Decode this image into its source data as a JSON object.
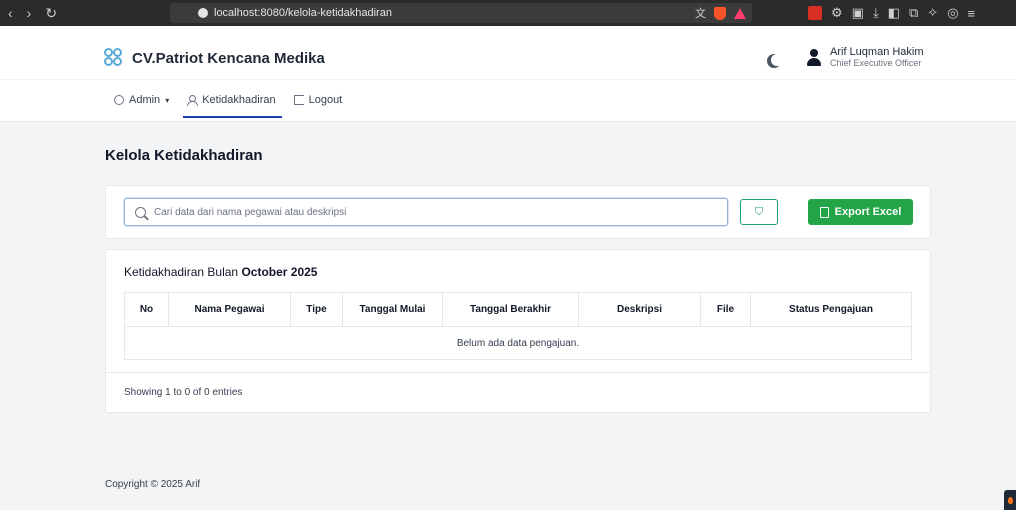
{
  "browser": {
    "url": "localhost:8080/kelola-ketidakhadiran",
    "nav_back": "‹",
    "nav_forward": "›",
    "nav_reload": "↻"
  },
  "header": {
    "brand": "CV.Patriot Kencana Medika",
    "user_name": "Arif Luqman Hakim",
    "user_role": "Chief Executive Officer"
  },
  "menu": {
    "items": [
      {
        "label": "Admin",
        "icon": "user-circle-icon"
      },
      {
        "label": "Ketidakhadiran",
        "icon": "person-x-icon"
      },
      {
        "label": "Logout",
        "icon": "logout-icon"
      }
    ],
    "active": "Ketidakhadiran"
  },
  "page": {
    "title": "Kelola Ketidakhadiran"
  },
  "search": {
    "placeholder": "Cari data dari nama pegawai atau deskripsi",
    "value": ""
  },
  "toolbar": {
    "export_label": "Export Excel"
  },
  "table": {
    "heading_prefix": "Ketidakhadiran Bulan",
    "heading_period": "October 2025",
    "columns": [
      "No",
      "Nama Pegawai",
      "Tipe",
      "Tanggal Mulai",
      "Tanggal Berakhir",
      "Deskripsi",
      "File",
      "Status Pengajuan"
    ],
    "empty_message": "Belum ada data pengajuan.",
    "showing": "Showing 1 to 0 of 0 entries"
  },
  "footer": {
    "copyright": "Copyright © 2025 Arif"
  },
  "colors": {
    "primary_active": "#1e40af",
    "export_green": "#22a447",
    "filter_green": "#22a06b"
  }
}
